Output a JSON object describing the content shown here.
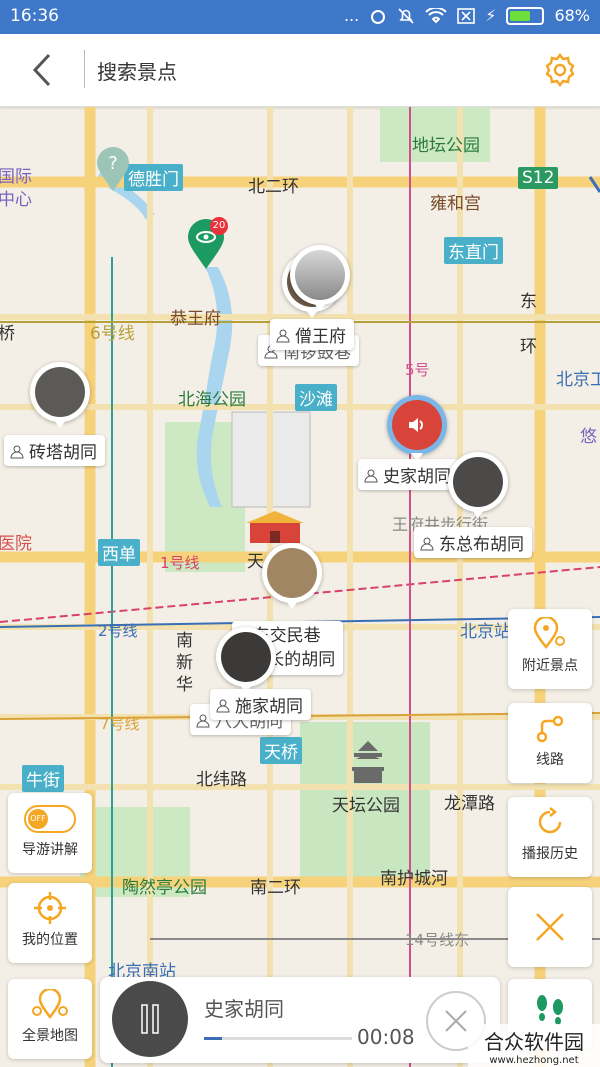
{
  "status_bar": {
    "time": "16:36",
    "battery": "68%",
    "dots": "..."
  },
  "header": {
    "title": "搜索景点"
  },
  "map": {
    "places": {
      "ditan": "地坛公园",
      "yonghegong": "雍和宫",
      "deshengmen": "德胜门",
      "beierhuan": "北二环",
      "s12": "S12",
      "dongzhimen": "东直门",
      "gongwangfu": "恭王府",
      "line6": "6号线",
      "beihai": "北海公园",
      "shatan": "沙滩",
      "dongsihuan": "东",
      "huan": "环",
      "beijinggong": "北京工",
      "you": "悠",
      "xidan": "西单",
      "line1": "1号线",
      "tian": "天",
      "wangfujing": "王府井步行街",
      "yiyuan": "医院",
      "line2": "2号线",
      "beijingzhan": "北京站",
      "nanxinhua": "南新华",
      "line7": "7号线",
      "tianqiao": "天桥",
      "niujie": "牛街",
      "beiweilu": "北纬路",
      "tiantan": "天坛公园",
      "longtanlu": "龙潭路",
      "taoranting": "陶然亭公园",
      "nanerhuan": "南二环",
      "nanhuchenghe": "南护城河",
      "line14": "14号线东",
      "beijingnan": "北京南站",
      "guoji": "国际",
      "zhongxin": "中心",
      "qiao": "桥",
      "line5": "5号",
      "pin_count": "20",
      "pin_q": "?"
    },
    "spots": {
      "sengwangfu": "僧王府",
      "nanluoguxiang": "南锣鼓巷",
      "zhuantahutong": "砖塔胡同",
      "shijiahutong": "史家胡同",
      "dongzongbu": "东总布胡同",
      "dongjiaominxiang_1": "东交民巷",
      "dongjiaominxiang_2": "--最长的胡同",
      "shijia2": "施家胡同",
      "badahutong": "八大胡同"
    }
  },
  "side_buttons": {
    "nearby": "附近景点",
    "route": "线路",
    "history": "播报历史",
    "guide": "导游讲解",
    "guide_toggle": "OFF",
    "mylocation": "我的位置"
  },
  "bottom": {
    "allmap": "全景地图",
    "player_title": "史家胡同",
    "player_time": "00:08",
    "watermark_main": "合众软件园",
    "watermark_url": "www.hezhong.net"
  },
  "colors": {
    "accent": "#f5a623",
    "statusbar": "#3f78c9",
    "red": "#e8323c"
  }
}
